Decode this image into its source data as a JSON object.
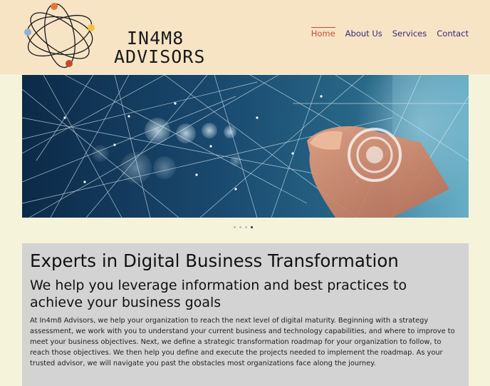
{
  "header": {
    "logo": {
      "line1": "IN4M8",
      "line2": "ADVISORS"
    },
    "nav": [
      {
        "label": "Home",
        "active": true
      },
      {
        "label": "About Us",
        "active": false
      },
      {
        "label": "Services",
        "active": false
      },
      {
        "label": "Contact",
        "active": false
      }
    ]
  },
  "hero": {
    "slide_count": 4,
    "active_slide": 4
  },
  "main": {
    "heading": "Experts in Digital Business Transformation",
    "subheading": "We help you leverage information and best practices to achieve your business goals",
    "body": "At In4m8 Advisors, we help your organization to reach the next level of digital maturity. Beginning with a strategy assessment, we work with you to understand your current business and technology capabilities, and where to improve to meet your business objectives. Next, we define a strategic transformation roadmap for your organization to follow, to reach those objectives. We then help you define and execute the projects needed to implement the roadmap. As your trusted advisor, we will navigate you past the obstacles most organizations face along the journey."
  },
  "colors": {
    "page_bg": "#f5f4db",
    "header_bg": "#f6e4c5",
    "nav_link": "#3a2a78",
    "nav_active": "#c44a3a",
    "content_bg": "#d3d3d3"
  }
}
